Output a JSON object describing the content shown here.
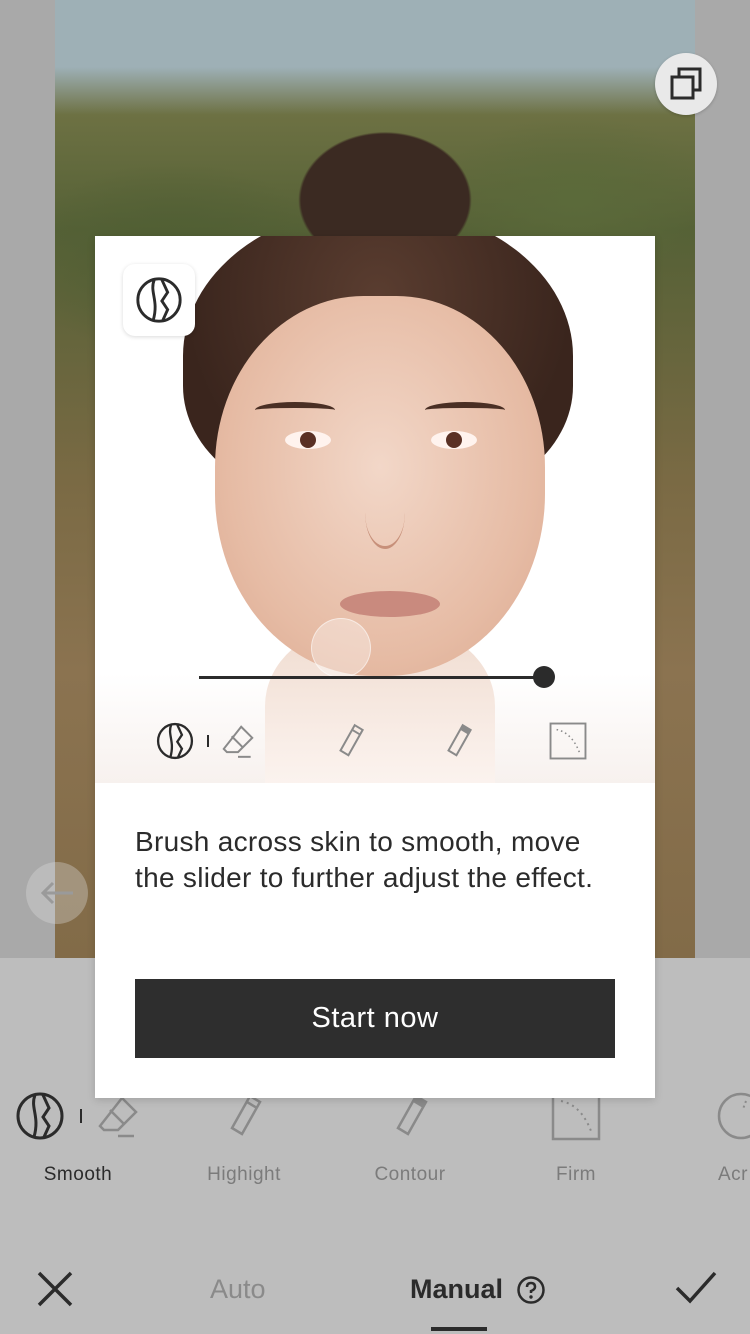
{
  "modal": {
    "description": "Brush across skin to smooth, move the slider to further adjust the effect.",
    "start_button": "Start now",
    "slider_value": 1.0
  },
  "tools": [
    {
      "label": "Smooth",
      "icon": "smooth-icon",
      "active": true
    },
    {
      "label": "Highight",
      "icon": "highlight-brush-icon",
      "active": false
    },
    {
      "label": "Contour",
      "icon": "contour-brush-icon",
      "active": false
    },
    {
      "label": "Firm",
      "icon": "firm-icon",
      "active": false
    },
    {
      "label": "Acr",
      "icon": "acne-icon",
      "active": false
    }
  ],
  "bottom_bar": {
    "auto": "Auto",
    "manual": "Manual",
    "selected": "Manual"
  },
  "colors": {
    "panel_bg": "#bdbdbd",
    "dark": "#2b2b2b",
    "muted": "#7b7b7b",
    "button_bg": "#2e2e2e"
  }
}
